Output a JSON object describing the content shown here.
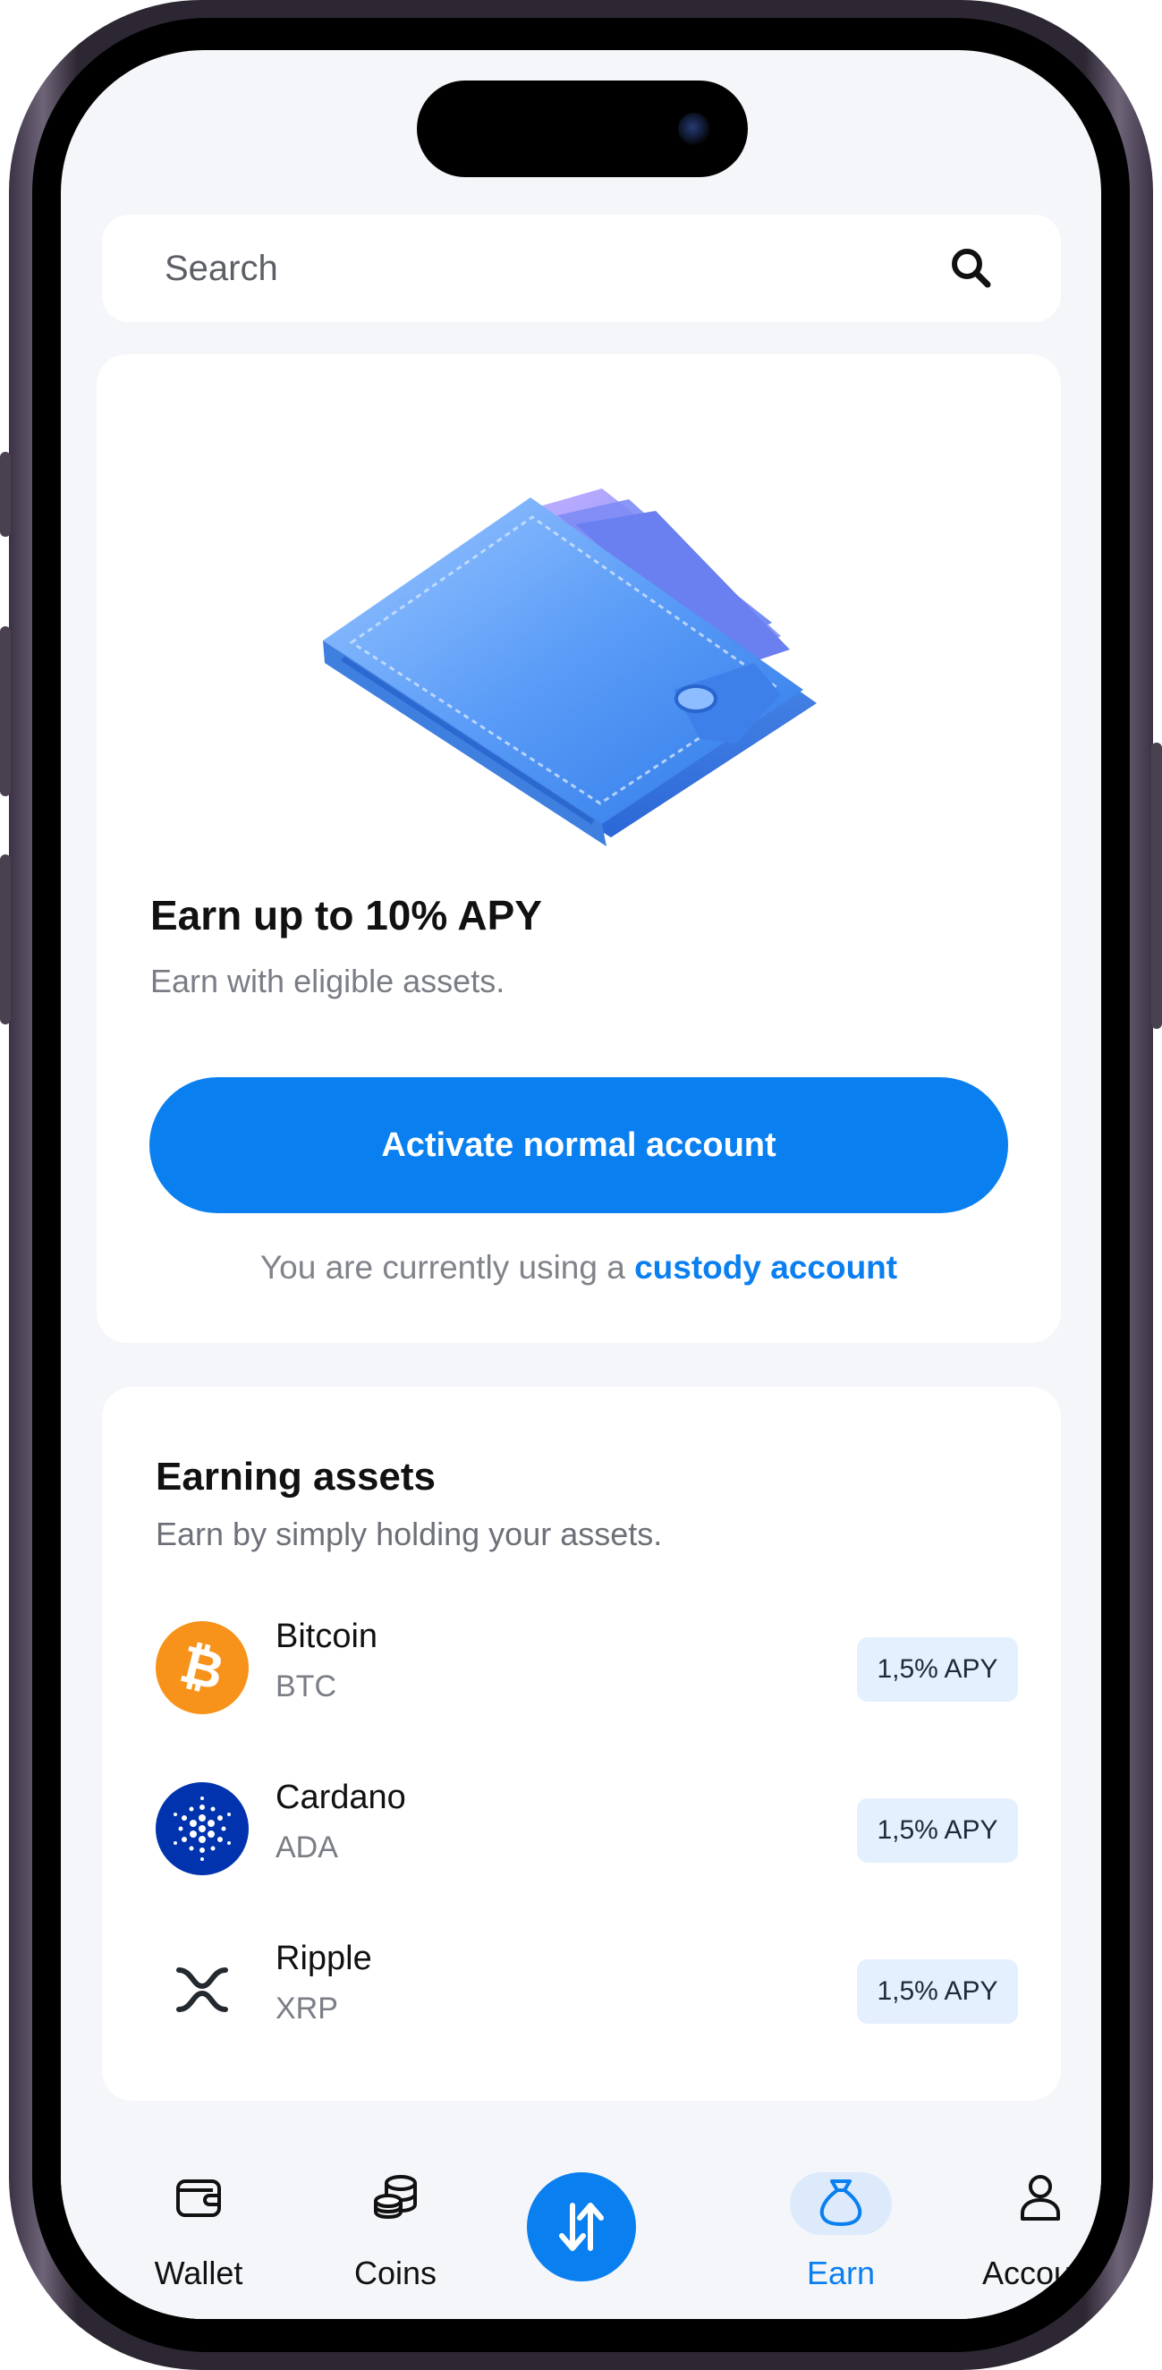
{
  "search": {
    "placeholder": "Search"
  },
  "promo": {
    "title": "Earn up to 10% APY",
    "subtitle": "Earn with eligible assets.",
    "button_label": "Activate normal account",
    "custody_prefix": "You are currently using a ",
    "custody_link": "custody account"
  },
  "assets": {
    "title": "Earning assets",
    "subtitle": "Earn by simply holding your assets.",
    "items": [
      {
        "name": "Bitcoin",
        "ticker": "BTC",
        "apy": "1,5% APY",
        "icon": "bitcoin-icon"
      },
      {
        "name": "Cardano",
        "ticker": "ADA",
        "apy": "1,5% APY",
        "icon": "cardano-icon"
      },
      {
        "name": "Ripple",
        "ticker": "XRP",
        "apy": "1,5% APY",
        "icon": "ripple-icon"
      }
    ]
  },
  "tabbar": {
    "active": "Earn",
    "items": [
      {
        "label": "Wallet",
        "icon": "wallet-icon"
      },
      {
        "label": "Coins",
        "icon": "coins-icon"
      },
      {
        "label": "",
        "icon": "swap-arrows-icon"
      },
      {
        "label": "Earn",
        "icon": "money-bag-icon"
      },
      {
        "label": "Account",
        "icon": "user-icon"
      }
    ]
  },
  "colors": {
    "accent": "#0A7FF0",
    "background": "#F4F6F9",
    "bitcoin": "#F7931A",
    "cardano": "#0033AD",
    "apy_badge": "#E4F0FD"
  }
}
